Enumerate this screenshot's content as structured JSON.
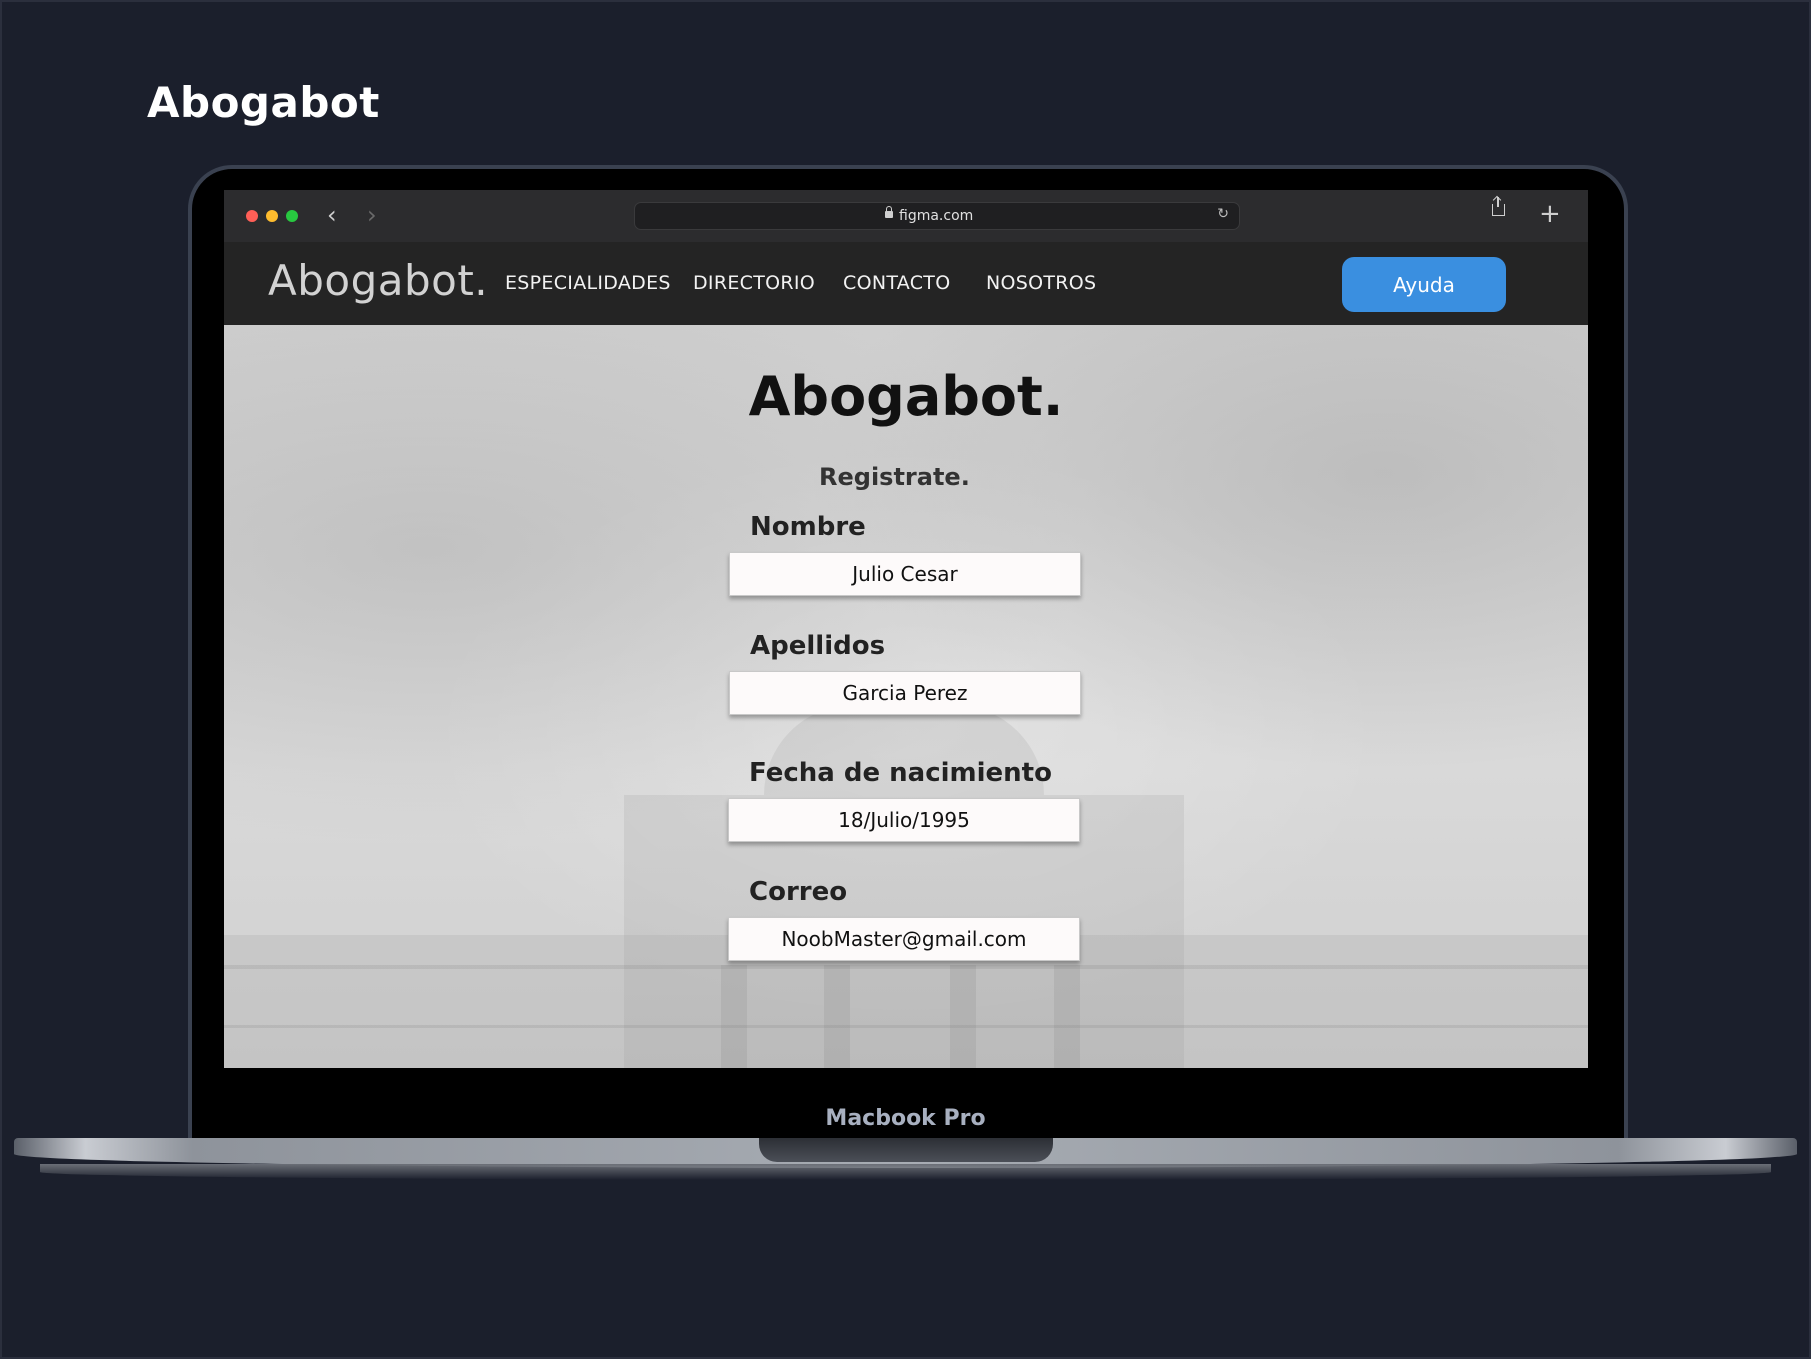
{
  "page": {
    "title": "Abogabot"
  },
  "browser": {
    "url": "figma.com",
    "back_symbol": "‹",
    "forward_symbol": "›",
    "reload_symbol": "↻",
    "plus_symbol": "+"
  },
  "site": {
    "logo": "Abogabot.",
    "nav": [
      "ESPECIALIDADES",
      "DIRECTORIO",
      "CONTACTO",
      "NOSOTROS"
    ],
    "help_label": "Ayuda",
    "accent": "#3a8fe0"
  },
  "form": {
    "heading": "Abogabot.",
    "subtitle": "Registrate.",
    "fields": [
      {
        "label": "Nombre",
        "value": "Julio Cesar"
      },
      {
        "label": "Apellidos",
        "value": "Garcia Perez"
      },
      {
        "label": "Fecha de nacimiento",
        "value": "18/Julio/1995"
      },
      {
        "label": "Correo",
        "value": "NoobMaster@gmail.com"
      }
    ]
  },
  "device": {
    "label": "Macbook Pro"
  },
  "icons": [
    "lock-icon",
    "reload-icon",
    "share-icon",
    "plus-icon",
    "back-arrow-icon",
    "forward-arrow-icon"
  ]
}
